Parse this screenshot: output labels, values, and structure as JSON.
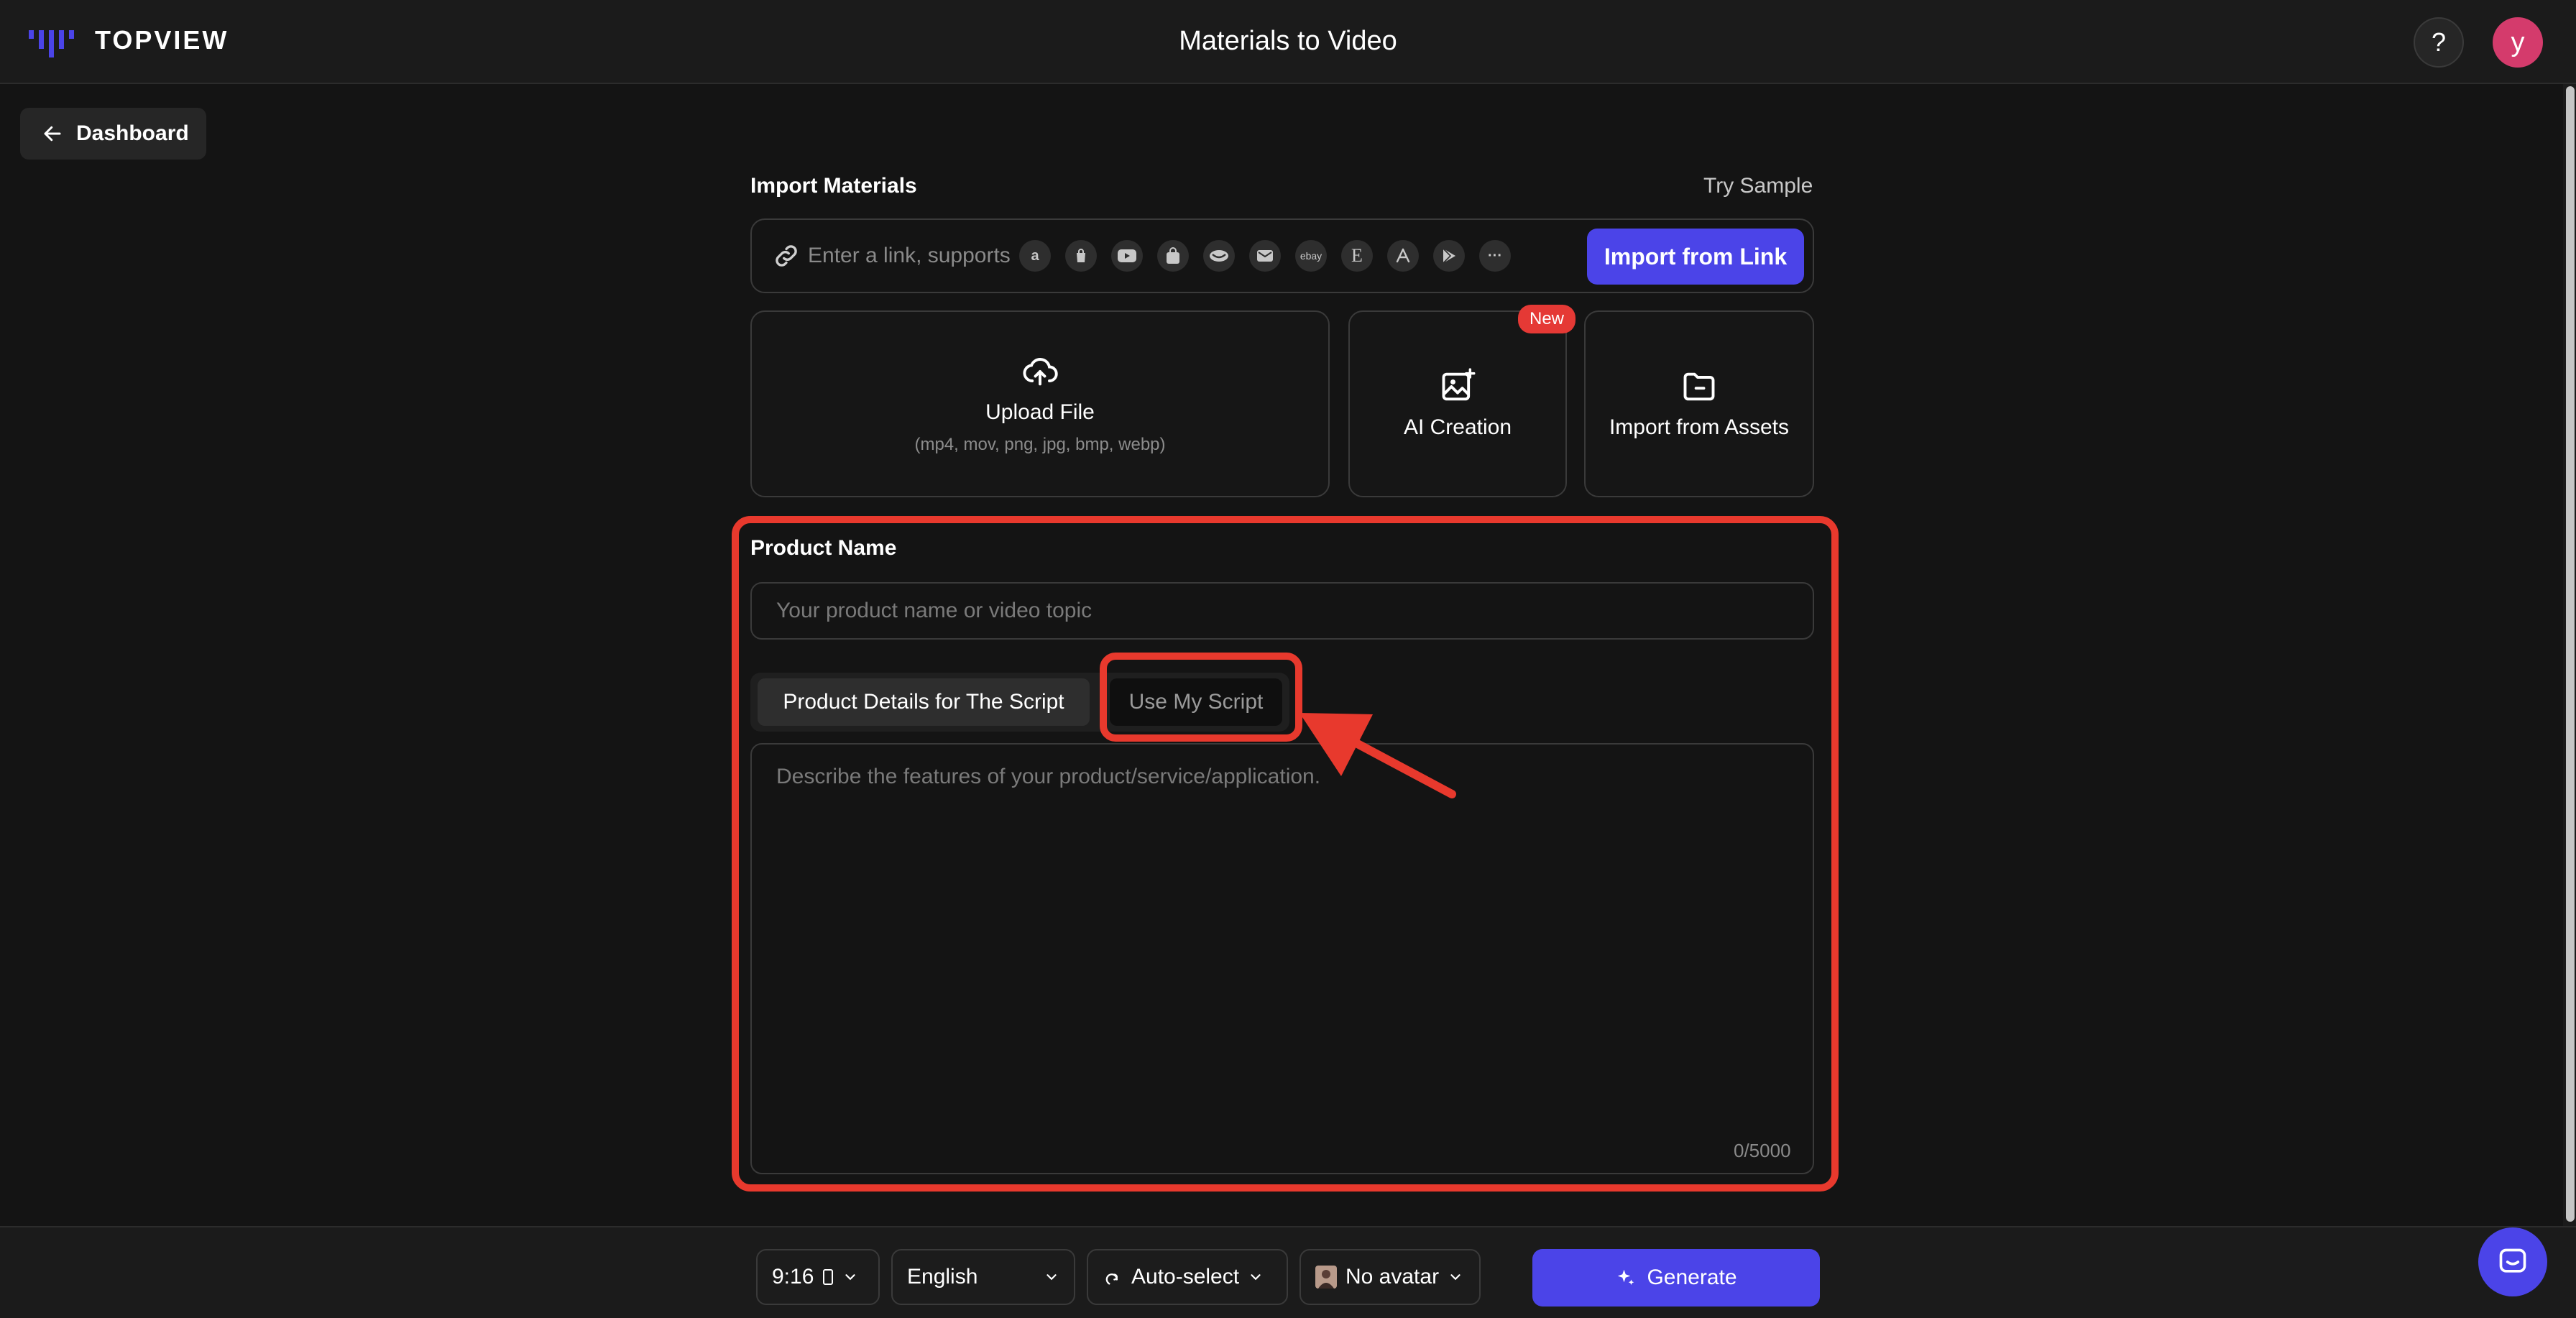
{
  "header": {
    "logo_text": "TOPVIEW",
    "title": "Materials to Video",
    "help_label": "?",
    "avatar_initial": "y"
  },
  "nav": {
    "back_label": "Dashboard"
  },
  "import": {
    "label": "Import Materials",
    "try_sample": "Try Sample",
    "link_placeholder": "Enter a link, supports",
    "platform_icons": [
      "amazon-icon",
      "shopify-icon",
      "youtube-icon",
      "shopping-bag-icon",
      "aliexpress-icon",
      "mail-icon",
      "ebay-icon",
      "etsy-icon",
      "app-store-icon",
      "google-play-icon",
      "more-icon"
    ],
    "platform_glyphs": {
      "amazon": "a",
      "ebay": "ebay",
      "etsy": "E",
      "more": "···"
    },
    "import_link_button": "Import from Link"
  },
  "cards": {
    "upload_title": "Upload File",
    "upload_formats": "(mp4, mov, png, jpg, bmp, webp)",
    "ai_title": "AI Creation",
    "ai_badge": "New",
    "assets_title": "Import from Assets"
  },
  "product": {
    "label": "Product Name",
    "name_placeholder": "Your product name or video topic",
    "tabs": [
      {
        "label": "Product Details for The Script",
        "active": true
      },
      {
        "label": "Use My Script",
        "active": false
      }
    ],
    "description_placeholder": "Describe the features of your product/service/application.",
    "char_count": "0/5000"
  },
  "bottom": {
    "aspect_ratio": "9:16",
    "language": "English",
    "voice": "Auto-select",
    "avatar": "No avatar",
    "generate_label": "Generate"
  },
  "colors": {
    "accent": "#4b44e8",
    "annotation": "#e8392d",
    "badge": "#e53935",
    "avatar": "#d43b6c"
  }
}
